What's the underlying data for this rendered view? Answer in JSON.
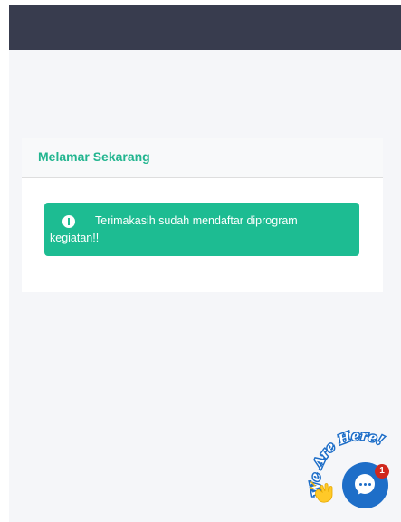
{
  "card": {
    "title": "Melamar Sekarang"
  },
  "alert": {
    "message": "Terimakasih sudah mendaftar diprogram kegiatan!!"
  },
  "chat_widget": {
    "tagline": "We Are Here!",
    "notification_count": "1",
    "icon": "chat-bubble-icon",
    "decoration_icon": "waving-hand-icon"
  },
  "colors": {
    "header_bar": "#383c4e",
    "accent_green": "#22b58f",
    "alert_background": "#1dbc92",
    "chat_blue": "#1e6ec8",
    "badge_red": "#d0281e"
  }
}
